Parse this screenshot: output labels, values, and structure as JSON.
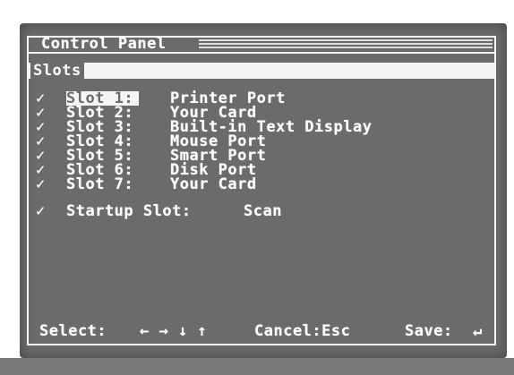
{
  "window": {
    "title": "Control Panel"
  },
  "section": {
    "title": "Slots"
  },
  "slots": [
    {
      "check": "✓",
      "label": "Slot 1:",
      "value": "Printer Port"
    },
    {
      "check": "✓",
      "label": "Slot 2:",
      "value": "Your Card"
    },
    {
      "check": "✓",
      "label": "Slot 3:",
      "value": "Built-in Text Display"
    },
    {
      "check": "✓",
      "label": "Slot 4:",
      "value": "Mouse Port"
    },
    {
      "check": "✓",
      "label": "Slot 5:",
      "value": "Smart Port"
    },
    {
      "check": "✓",
      "label": "Slot 6:",
      "value": "Disk Port"
    },
    {
      "check": "✓",
      "label": "Slot 7:",
      "value": "Your Card"
    }
  ],
  "startup": {
    "check": "✓",
    "label": "Startup Slot:",
    "value": "Scan"
  },
  "footer": {
    "select_label": "Select:",
    "arrows": "← → ↓ ↑",
    "cancel_label": "Cancel:Esc",
    "save_label": "Save:",
    "save_key": "↵"
  },
  "colors": {
    "screen_background": "#6b6b6b",
    "foreground": "#ffffff"
  }
}
